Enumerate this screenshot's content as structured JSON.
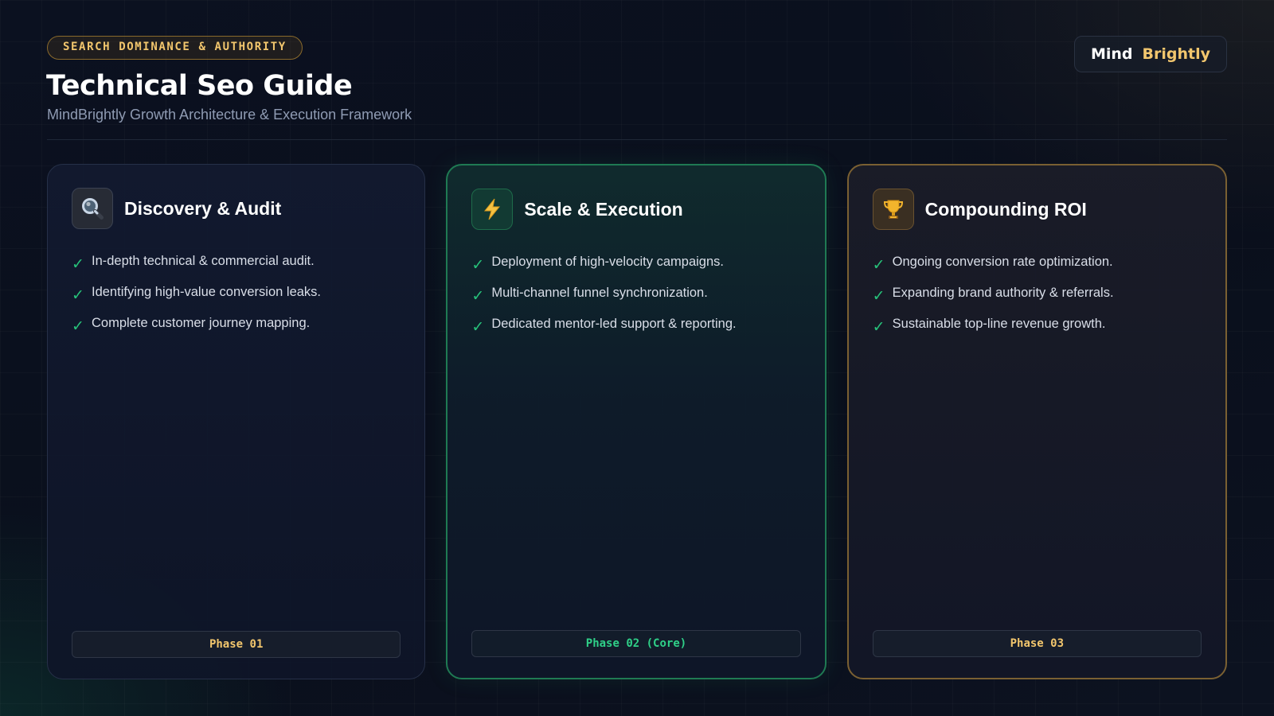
{
  "header": {
    "eyebrow": "SEARCH DOMINANCE & AUTHORITY",
    "title": "Technical Seo Guide",
    "subtitle": "MindBrightly Growth Architecture & Execution Framework"
  },
  "brand": {
    "first": "Mind",
    "second": "Brightly"
  },
  "colors": {
    "accent_gold": "#f2c66d",
    "accent_green": "#27c27a",
    "background": "#0a0f1c"
  },
  "cards": [
    {
      "icon": "magnifying-glass-icon",
      "title": "Discovery & Audit",
      "items": [
        "In-depth technical & commercial audit.",
        "Identifying high-value conversion leaks.",
        "Complete customer journey mapping."
      ],
      "phase": "Phase 01"
    },
    {
      "icon": "lightning-bolt-icon",
      "title": "Scale & Execution",
      "items": [
        "Deployment of high-velocity campaigns.",
        "Multi-channel funnel synchronization.",
        "Dedicated mentor-led support & reporting."
      ],
      "phase": "Phase 02 (Core)"
    },
    {
      "icon": "trophy-icon",
      "title": "Compounding ROI",
      "items": [
        "Ongoing conversion rate optimization.",
        "Expanding brand authority & referrals.",
        "Sustainable top-line revenue growth."
      ],
      "phase": "Phase 03"
    }
  ]
}
